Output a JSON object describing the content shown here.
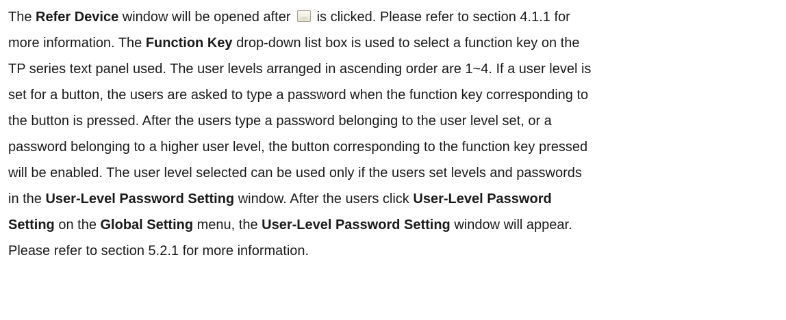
{
  "icons": {
    "ellipsis_button": "ellipsis-button-icon",
    "ellipsis_glyph": "..."
  },
  "paragraph": {
    "lines": [
      [
        {
          "text": "The ",
          "bold": false
        },
        {
          "text": "Refer Device",
          "bold": true
        },
        {
          "text": " window will be opened after ",
          "bold": false
        },
        {
          "icon": "ellipsis_button"
        },
        {
          "text": " is clicked. Please refer to section 4.1.1 for",
          "bold": false
        }
      ],
      [
        {
          "text": "more information. The ",
          "bold": false
        },
        {
          "text": "Function Key",
          "bold": true
        },
        {
          "text": " drop-down list box is used to select a function key on the",
          "bold": false
        }
      ],
      [
        {
          "text": "TP series text panel used. The user levels arranged in ascending order are 1~4. If a user level is",
          "bold": false
        }
      ],
      [
        {
          "text": "set for a button, the users are asked to type a password when the function key corresponding to",
          "bold": false
        }
      ],
      [
        {
          "text": "the button is pressed. After the users type a password belonging to the user level set, or a",
          "bold": false
        }
      ],
      [
        {
          "text": "password belonging to a higher user level, the button corresponding to the function key pressed",
          "bold": false
        }
      ],
      [
        {
          "text": "will be enabled. The user level selected can be used only if the users set levels and passwords",
          "bold": false
        }
      ],
      [
        {
          "text": "in the ",
          "bold": false
        },
        {
          "text": "User-Level Password Setting",
          "bold": true
        },
        {
          "text": " window. After the users click ",
          "bold": false
        },
        {
          "text": "User-Level Password",
          "bold": true
        }
      ],
      [
        {
          "text": "Setting",
          "bold": true
        },
        {
          "text": " on the ",
          "bold": false
        },
        {
          "text": "Global Setting",
          "bold": true
        },
        {
          "text": " menu, the ",
          "bold": false
        },
        {
          "text": "User-Level Password Setting",
          "bold": true
        },
        {
          "text": " window will appear.",
          "bold": false
        }
      ],
      [
        {
          "text": "Please refer to section 5.2.1 for more information.",
          "bold": false
        }
      ]
    ]
  }
}
